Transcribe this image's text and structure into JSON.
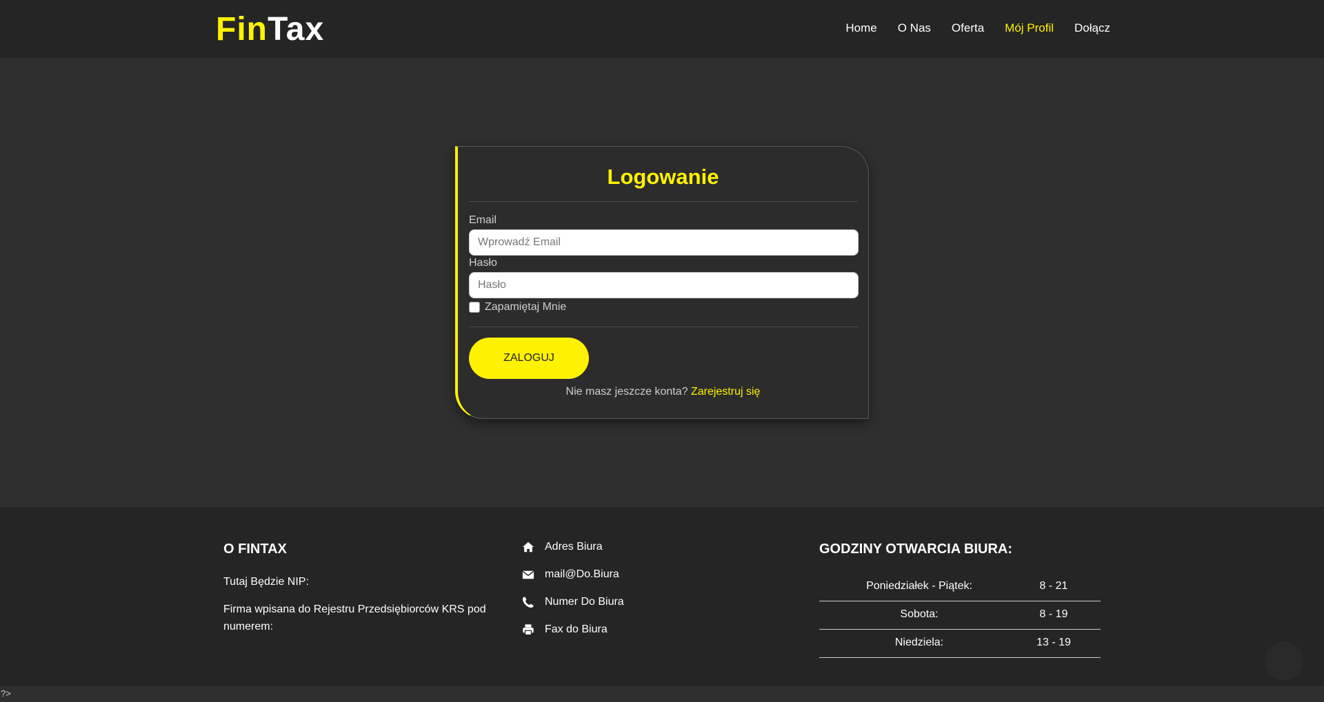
{
  "brand": {
    "part1": "Fin",
    "part2": "Tax",
    "accent": "#fff200"
  },
  "nav": {
    "items": [
      {
        "label": "Home"
      },
      {
        "label": "O Nas"
      },
      {
        "label": "Oferta"
      },
      {
        "label": "Mój Profil",
        "active": true
      },
      {
        "label": "Dołącz"
      }
    ]
  },
  "login": {
    "title": "Logowanie",
    "email_label": "Email",
    "email_placeholder": "Wprowadź Email",
    "password_label": "Hasło",
    "password_placeholder": "Hasło",
    "remember_label": "Zapamiętaj Mnie",
    "submit_label": "ZALOGUJ",
    "no_account_text": "Nie masz jeszcze konta?",
    "register_link": "Zarejestruj się"
  },
  "footer": {
    "about": {
      "heading": "O FINTAX",
      "nip": "Tutaj Będzie NIP:",
      "krs": "Firma wpisana do Rejestru Przedsiębiorców KRS pod numerem:"
    },
    "contact": [
      {
        "icon": "home-icon",
        "text": "Adres Biura"
      },
      {
        "icon": "envelope-icon",
        "text": "mail@Do.Biura"
      },
      {
        "icon": "phone-icon",
        "text": "Numer Do Biura"
      },
      {
        "icon": "printer-icon",
        "text": "Fax do Biura"
      }
    ],
    "hours": {
      "heading": "GODZINY OTWARCIA BIURA:",
      "rows": [
        {
          "day": "Poniedziałek - Piątek:",
          "time": "8 - 21"
        },
        {
          "day": "Sobota:",
          "time": "8 - 19"
        },
        {
          "day": "Niedziela:",
          "time": "13 - 19"
        }
      ]
    }
  },
  "bottom_text": "?>"
}
